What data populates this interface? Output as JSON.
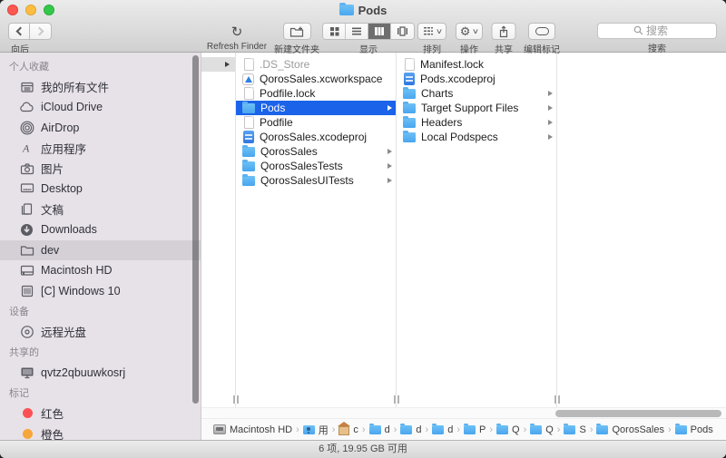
{
  "window": {
    "title": "Pods"
  },
  "toolbar": {
    "back_label": "向后",
    "refresh_glyph": "↻",
    "refresh_label": "Refresh Finder",
    "new_folder_label": "新建文件夹",
    "view_label": "显示",
    "arrange_label": "排列",
    "action_glyph": "⚙",
    "action_label": "操作",
    "share_label": "共享",
    "tags_label": "编辑标记",
    "search_label": "搜索",
    "search_placeholder": "搜索",
    "dropdown_chevron": "∨"
  },
  "sidebar": {
    "items": [
      {
        "label": "个人收藏",
        "type": "header"
      },
      {
        "label": "我的所有文件",
        "icon": "all-files"
      },
      {
        "label": "iCloud Drive",
        "icon": "cloud"
      },
      {
        "label": "AirDrop",
        "icon": "airdrop"
      },
      {
        "label": "应用程序",
        "icon": "applications"
      },
      {
        "label": "图片",
        "icon": "photos"
      },
      {
        "label": "Desktop",
        "icon": "desktop"
      },
      {
        "label": "文稿",
        "icon": "documents"
      },
      {
        "label": "Downloads",
        "icon": "downloads"
      },
      {
        "label": "dev",
        "icon": "folder",
        "selected": true
      },
      {
        "label": "Macintosh HD",
        "icon": "hard-drive"
      },
      {
        "label": "[C] Windows 10",
        "icon": "bootcamp-drive"
      },
      {
        "label": "设备",
        "type": "header"
      },
      {
        "label": "远程光盘",
        "icon": "optical-disc"
      },
      {
        "label": "共享的",
        "type": "header"
      },
      {
        "label": "qvtz2qbuuwkosrj",
        "icon": "shared-display"
      },
      {
        "label": "标记",
        "type": "header"
      },
      {
        "label": "红色",
        "icon": "red-dot"
      },
      {
        "label": "橙色",
        "icon": "orange-dot"
      }
    ]
  },
  "columns": {
    "col1": {
      "items": [
        {
          "name": ".DS_Store",
          "icon": "doc",
          "dimmed": true
        },
        {
          "name": "QorosSales.xcworkspace",
          "icon": "xcworkspace"
        },
        {
          "name": "Podfile.lock",
          "icon": "doc"
        },
        {
          "name": "Pods",
          "icon": "folder",
          "selected": true,
          "arrow": true
        },
        {
          "name": "Podfile",
          "icon": "doc"
        },
        {
          "name": "QorosSales.xcodeproj",
          "icon": "xcodeproj"
        },
        {
          "name": "QorosSales",
          "icon": "folder",
          "arrow": true
        },
        {
          "name": "QorosSalesTests",
          "icon": "folder",
          "arrow": true
        },
        {
          "name": "QorosSalesUITests",
          "icon": "folder",
          "arrow": true
        }
      ]
    },
    "col2": {
      "items": [
        {
          "name": "Manifest.lock",
          "icon": "doc"
        },
        {
          "name": "Pods.xcodeproj",
          "icon": "xcodeproj"
        },
        {
          "name": "Charts",
          "icon": "folder",
          "arrow": true
        },
        {
          "name": "Target Support Files",
          "icon": "folder",
          "arrow": true
        },
        {
          "name": "Headers",
          "icon": "folder",
          "arrow": true
        },
        {
          "name": "Local Podspecs",
          "icon": "folder",
          "arrow": true
        }
      ]
    }
  },
  "pathbar": {
    "separator": "›",
    "items": [
      {
        "label": "Macintosh HD",
        "icon": "drive"
      },
      {
        "label": "用",
        "icon": "users-folder"
      },
      {
        "label": "c",
        "icon": "home"
      },
      {
        "label": "d",
        "icon": "folder"
      },
      {
        "label": "d",
        "icon": "folder"
      },
      {
        "label": "d",
        "icon": "folder"
      },
      {
        "label": "P",
        "icon": "folder"
      },
      {
        "label": "Q",
        "icon": "folder"
      },
      {
        "label": "Q",
        "icon": "folder"
      },
      {
        "label": "S",
        "icon": "folder"
      },
      {
        "label": "QorosSales",
        "icon": "folder"
      },
      {
        "label": "Pods",
        "icon": "folder"
      }
    ]
  },
  "statusbar": {
    "text": "6 项, 19.95 GB 可用"
  }
}
